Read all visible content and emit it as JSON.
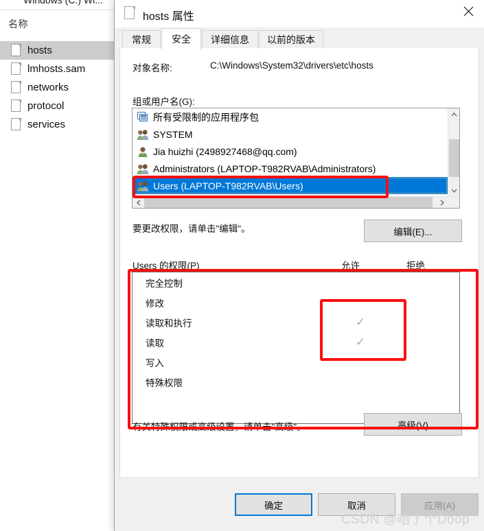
{
  "explorer": {
    "clipped_title": "Windows (C:)    Wi...",
    "column_header": "名称",
    "files": [
      {
        "name": "hosts",
        "icon": "file-icon",
        "selected": true
      },
      {
        "name": "lmhosts.sam",
        "icon": "file-icon",
        "selected": false
      },
      {
        "name": "networks",
        "icon": "file-icon",
        "selected": false
      },
      {
        "name": "protocol",
        "icon": "file-icon",
        "selected": false
      },
      {
        "name": "services",
        "icon": "file-icon",
        "selected": false
      }
    ]
  },
  "dialog": {
    "title": "hosts 属性",
    "title_icon": "file-icon",
    "close_icon": "close-icon",
    "tabs": [
      {
        "label": "常规",
        "active": false
      },
      {
        "label": "安全",
        "active": true
      },
      {
        "label": "详细信息",
        "active": false
      },
      {
        "label": "以前的版本",
        "active": false
      }
    ],
    "object_name_label": "对象名称:",
    "object_name_value": "C:\\Windows\\System32\\drivers\\etc\\hosts",
    "group_user_label": "组或用户名(G):",
    "principals": [
      {
        "name": "所有受限制的应用程序包",
        "icon": "app-package-icon",
        "selected": false
      },
      {
        "name": "SYSTEM",
        "icon": "group-icon",
        "selected": false
      },
      {
        "name": "Jia huizhi (2498927468@qq.com)",
        "icon": "user-icon",
        "selected": false
      },
      {
        "name": "Administrators (LAPTOP-T982RVAB\\Administrators)",
        "icon": "group-icon",
        "selected": false
      },
      {
        "name": "Users (LAPTOP-T982RVAB\\Users)",
        "icon": "group-icon",
        "selected": true
      }
    ],
    "scrollbar": {
      "up_icon": "chevron-up-icon",
      "down_icon": "chevron-down-icon",
      "left_icon": "chevron-left-icon",
      "right_icon": "chevron-right-icon"
    },
    "change_hint": "要更改权限，请单击\"编辑\"。",
    "edit_button": "编辑(E)...",
    "permissions_title": "Users 的权限(P)",
    "allow_header": "允许",
    "deny_header": "拒绝",
    "permissions": [
      {
        "name": "完全控制",
        "allow": false,
        "deny": false
      },
      {
        "name": "修改",
        "allow": false,
        "deny": false
      },
      {
        "name": "读取和执行",
        "allow": true,
        "deny": false
      },
      {
        "name": "读取",
        "allow": true,
        "deny": false
      },
      {
        "name": "写入",
        "allow": false,
        "deny": false
      },
      {
        "name": "特殊权限",
        "allow": false,
        "deny": false
      }
    ],
    "check_glyph": "✓",
    "advanced_hint": "有关特殊权限或高级设置，请单击\"高级\"。",
    "advanced_button": "高级(V)",
    "ok_button": "确定",
    "cancel_button": "取消",
    "apply_button": "应用(A)"
  },
  "watermark": "CSDN @咍了个Doop",
  "colors": {
    "selection_blue": "#0078d7",
    "annotation_red": "#fb0e0e",
    "dialog_face": "#f0f0f0",
    "check_gray": "#a8a8a8"
  }
}
